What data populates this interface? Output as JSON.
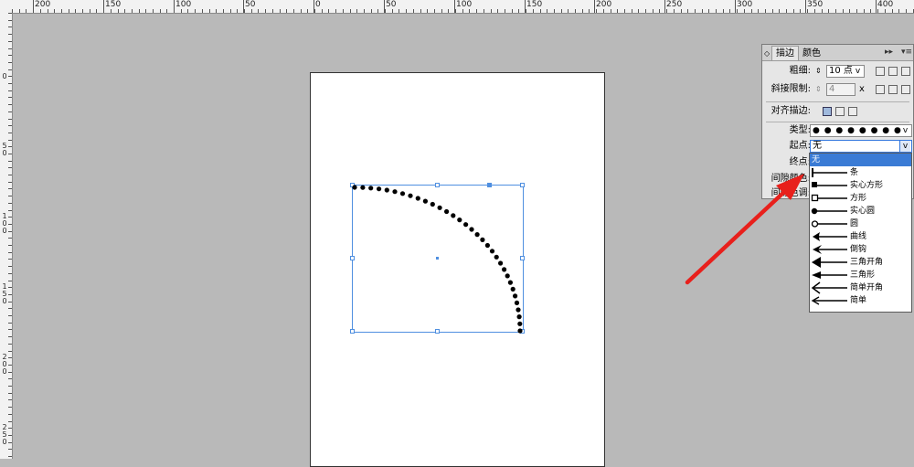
{
  "ruler": {
    "h_labels": [
      "200",
      "150",
      "100",
      "50",
      "0",
      "50",
      "100",
      "150",
      "200",
      "250",
      "300",
      "350",
      "400",
      "45"
    ],
    "v_labels": [
      "0",
      "50",
      "100",
      "150",
      "200",
      "250"
    ]
  },
  "stroke_panel": {
    "tabs": [
      {
        "label": "描边",
        "active": true
      },
      {
        "label": "颜色",
        "active": false
      }
    ],
    "menu_icons": [
      "collapse-icon",
      "panel-menu-icon"
    ],
    "weight_label": "粗细:",
    "weight_value": "10 点",
    "miter_label": "斜接限制:",
    "miter_value": "4",
    "miter_unit": "x",
    "align_label": "对齐描边:",
    "type_label": "类型:",
    "type_value": "● ● ● ● ● ● ● ●",
    "start_label": "起点:",
    "start_value": "无",
    "end_label": "终点:",
    "gap_color_label": "间隙颜色:",
    "gap_tint_label": "间隙色调:"
  },
  "start_dropdown": {
    "options": [
      {
        "label": "无",
        "icon": "none",
        "selected": true
      },
      {
        "label": "条",
        "icon": "bar",
        "selected": false
      },
      {
        "label": "实心方形",
        "icon": "solid-square",
        "selected": false
      },
      {
        "label": "方形",
        "icon": "square",
        "selected": false
      },
      {
        "label": "实心圆",
        "icon": "solid-circle",
        "selected": false
      },
      {
        "label": "圆",
        "icon": "circle",
        "selected": false
      },
      {
        "label": "曲线",
        "icon": "curve-arrow",
        "selected": false
      },
      {
        "label": "倒钩",
        "icon": "barb-arrow",
        "selected": false
      },
      {
        "label": "三角开角",
        "icon": "triangle-wide",
        "selected": false
      },
      {
        "label": "三角形",
        "icon": "triangle",
        "selected": false
      },
      {
        "label": "简单开角",
        "icon": "simple-wide",
        "selected": false
      },
      {
        "label": "简单",
        "icon": "simple",
        "selected": false
      }
    ]
  },
  "colors": {
    "canvas_bg": "#b9b9b9",
    "selection": "#4f8fe0",
    "highlight": "#3a7bd5",
    "annotation_arrow": "#e8201c",
    "stroke": "#000000"
  }
}
